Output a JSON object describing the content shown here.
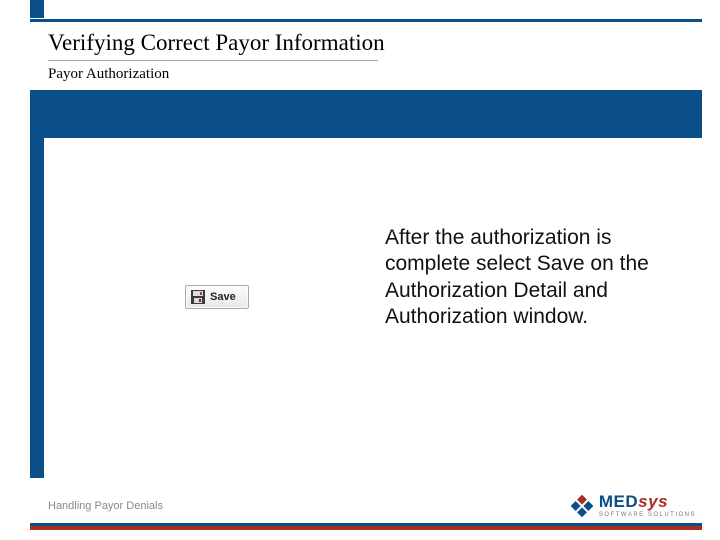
{
  "header": {
    "title": "Verifying Correct Payor Information",
    "subtitle": "Payor Authorization"
  },
  "content": {
    "save_button_label": "Save",
    "save_button_icon": "floppy-disk-icon",
    "body_text": "After the authorization is complete select Save on the Authorization Detail and Authorization window."
  },
  "footer": {
    "label": "Handling Payor Denials"
  },
  "logo": {
    "brand_part1": "MED",
    "brand_part2": "sys",
    "tagline": "SOFTWARE SOLUTIONS",
    "mark": "diamond-cluster-icon"
  },
  "colors": {
    "blue": "#0b4f8a",
    "red": "#a82d23"
  }
}
